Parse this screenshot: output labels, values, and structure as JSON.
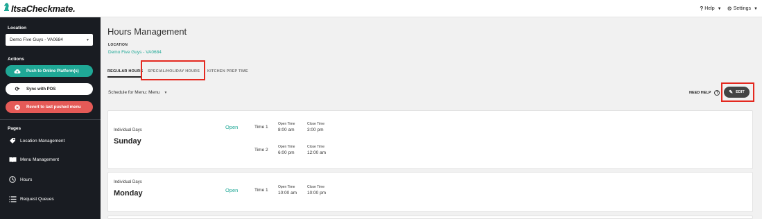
{
  "app": {
    "logo_text": "ItsaCheckmate.",
    "help_label": "Help",
    "settings_label": "Settings"
  },
  "sidebar": {
    "location_heading": "Location",
    "location_value": "Demo Five Guys - VA0684",
    "actions_heading": "Actions",
    "push_label": "Push to Online Platform(s)",
    "sync_label": "Sync with POS",
    "revert_label": "Revert to last pushed menu",
    "pages_heading": "Pages",
    "pages": [
      {
        "label": "Location Management",
        "icon": "tag-icon"
      },
      {
        "label": "Menu Management",
        "icon": "menu-book-icon"
      },
      {
        "label": "Hours",
        "icon": "clock-icon"
      },
      {
        "label": "Request Queues",
        "icon": "list-icon"
      }
    ]
  },
  "main": {
    "title": "Hours Management",
    "location_label": "LOCATION",
    "location_value": "Demo Five Guys - VA0684",
    "tabs": [
      {
        "label": "REGULAR HOURS",
        "active": true
      },
      {
        "label": "SPECIAL/HOLIDAY HOURS",
        "active": false
      },
      {
        "label": "KITCHEN PREP TIME",
        "active": false
      }
    ],
    "schedule_label": "Schedule for Menu: Menu",
    "need_help_label": "NEED HELP",
    "edit_label": "EDIT"
  },
  "days": [
    {
      "type_label": "Individual Days",
      "day": "Sunday",
      "status": "Open",
      "times": [
        {
          "label": "Time 1",
          "open_label": "Open Time",
          "open": "8:00 am",
          "close_label": "Close Time",
          "close": "3:00 pm"
        },
        {
          "label": "Time 2",
          "open_label": "Open Time",
          "open": "6:00 pm",
          "close_label": "Close Time",
          "close": "12:00 am"
        }
      ]
    },
    {
      "type_label": "Individual Days",
      "day": "Monday",
      "status": "Open",
      "times": [
        {
          "label": "Time 1",
          "open_label": "Open Time",
          "open": "10:00 am",
          "close_label": "Close Time",
          "close": "10:00 pm"
        }
      ]
    }
  ],
  "colors": {
    "accent": "#1fa896",
    "danger": "#e55a57",
    "sidebar_bg": "#191c22",
    "highlight": "#e4281f"
  }
}
